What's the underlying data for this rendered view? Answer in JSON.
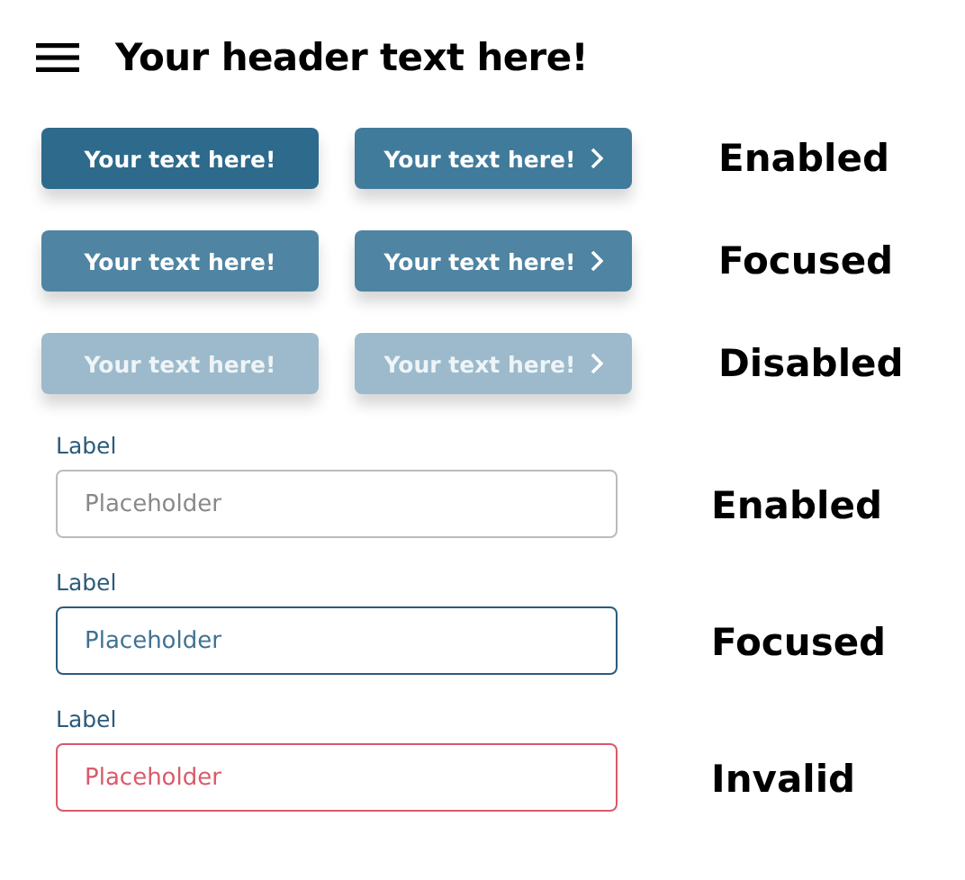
{
  "header": {
    "title": "Your header text here!"
  },
  "button_rows": [
    {
      "kind": "enabled",
      "caption": "Enabled",
      "buttons": [
        {
          "kind": "plain",
          "label": "Your text here!"
        },
        {
          "kind": "chevron",
          "label": "Your text here!"
        }
      ]
    },
    {
      "kind": "focused",
      "caption": "Focused",
      "buttons": [
        {
          "kind": "plain",
          "label": "Your text here!"
        },
        {
          "kind": "chevron",
          "label": "Your text here!"
        }
      ]
    },
    {
      "kind": "disabled",
      "caption": "Disabled",
      "buttons": [
        {
          "kind": "plain",
          "label": "Your text here!"
        },
        {
          "kind": "chevron",
          "label": "Your text here!"
        }
      ]
    }
  ],
  "field_rows": [
    {
      "kind": "enabled",
      "label": "Label",
      "placeholder": "Placeholder",
      "caption": "Enabled"
    },
    {
      "kind": "focused",
      "label": "Label",
      "placeholder": "Placeholder",
      "caption": "Focused"
    },
    {
      "kind": "invalid",
      "label": "Label",
      "placeholder": "Placeholder",
      "caption": "Invalid"
    }
  ]
}
